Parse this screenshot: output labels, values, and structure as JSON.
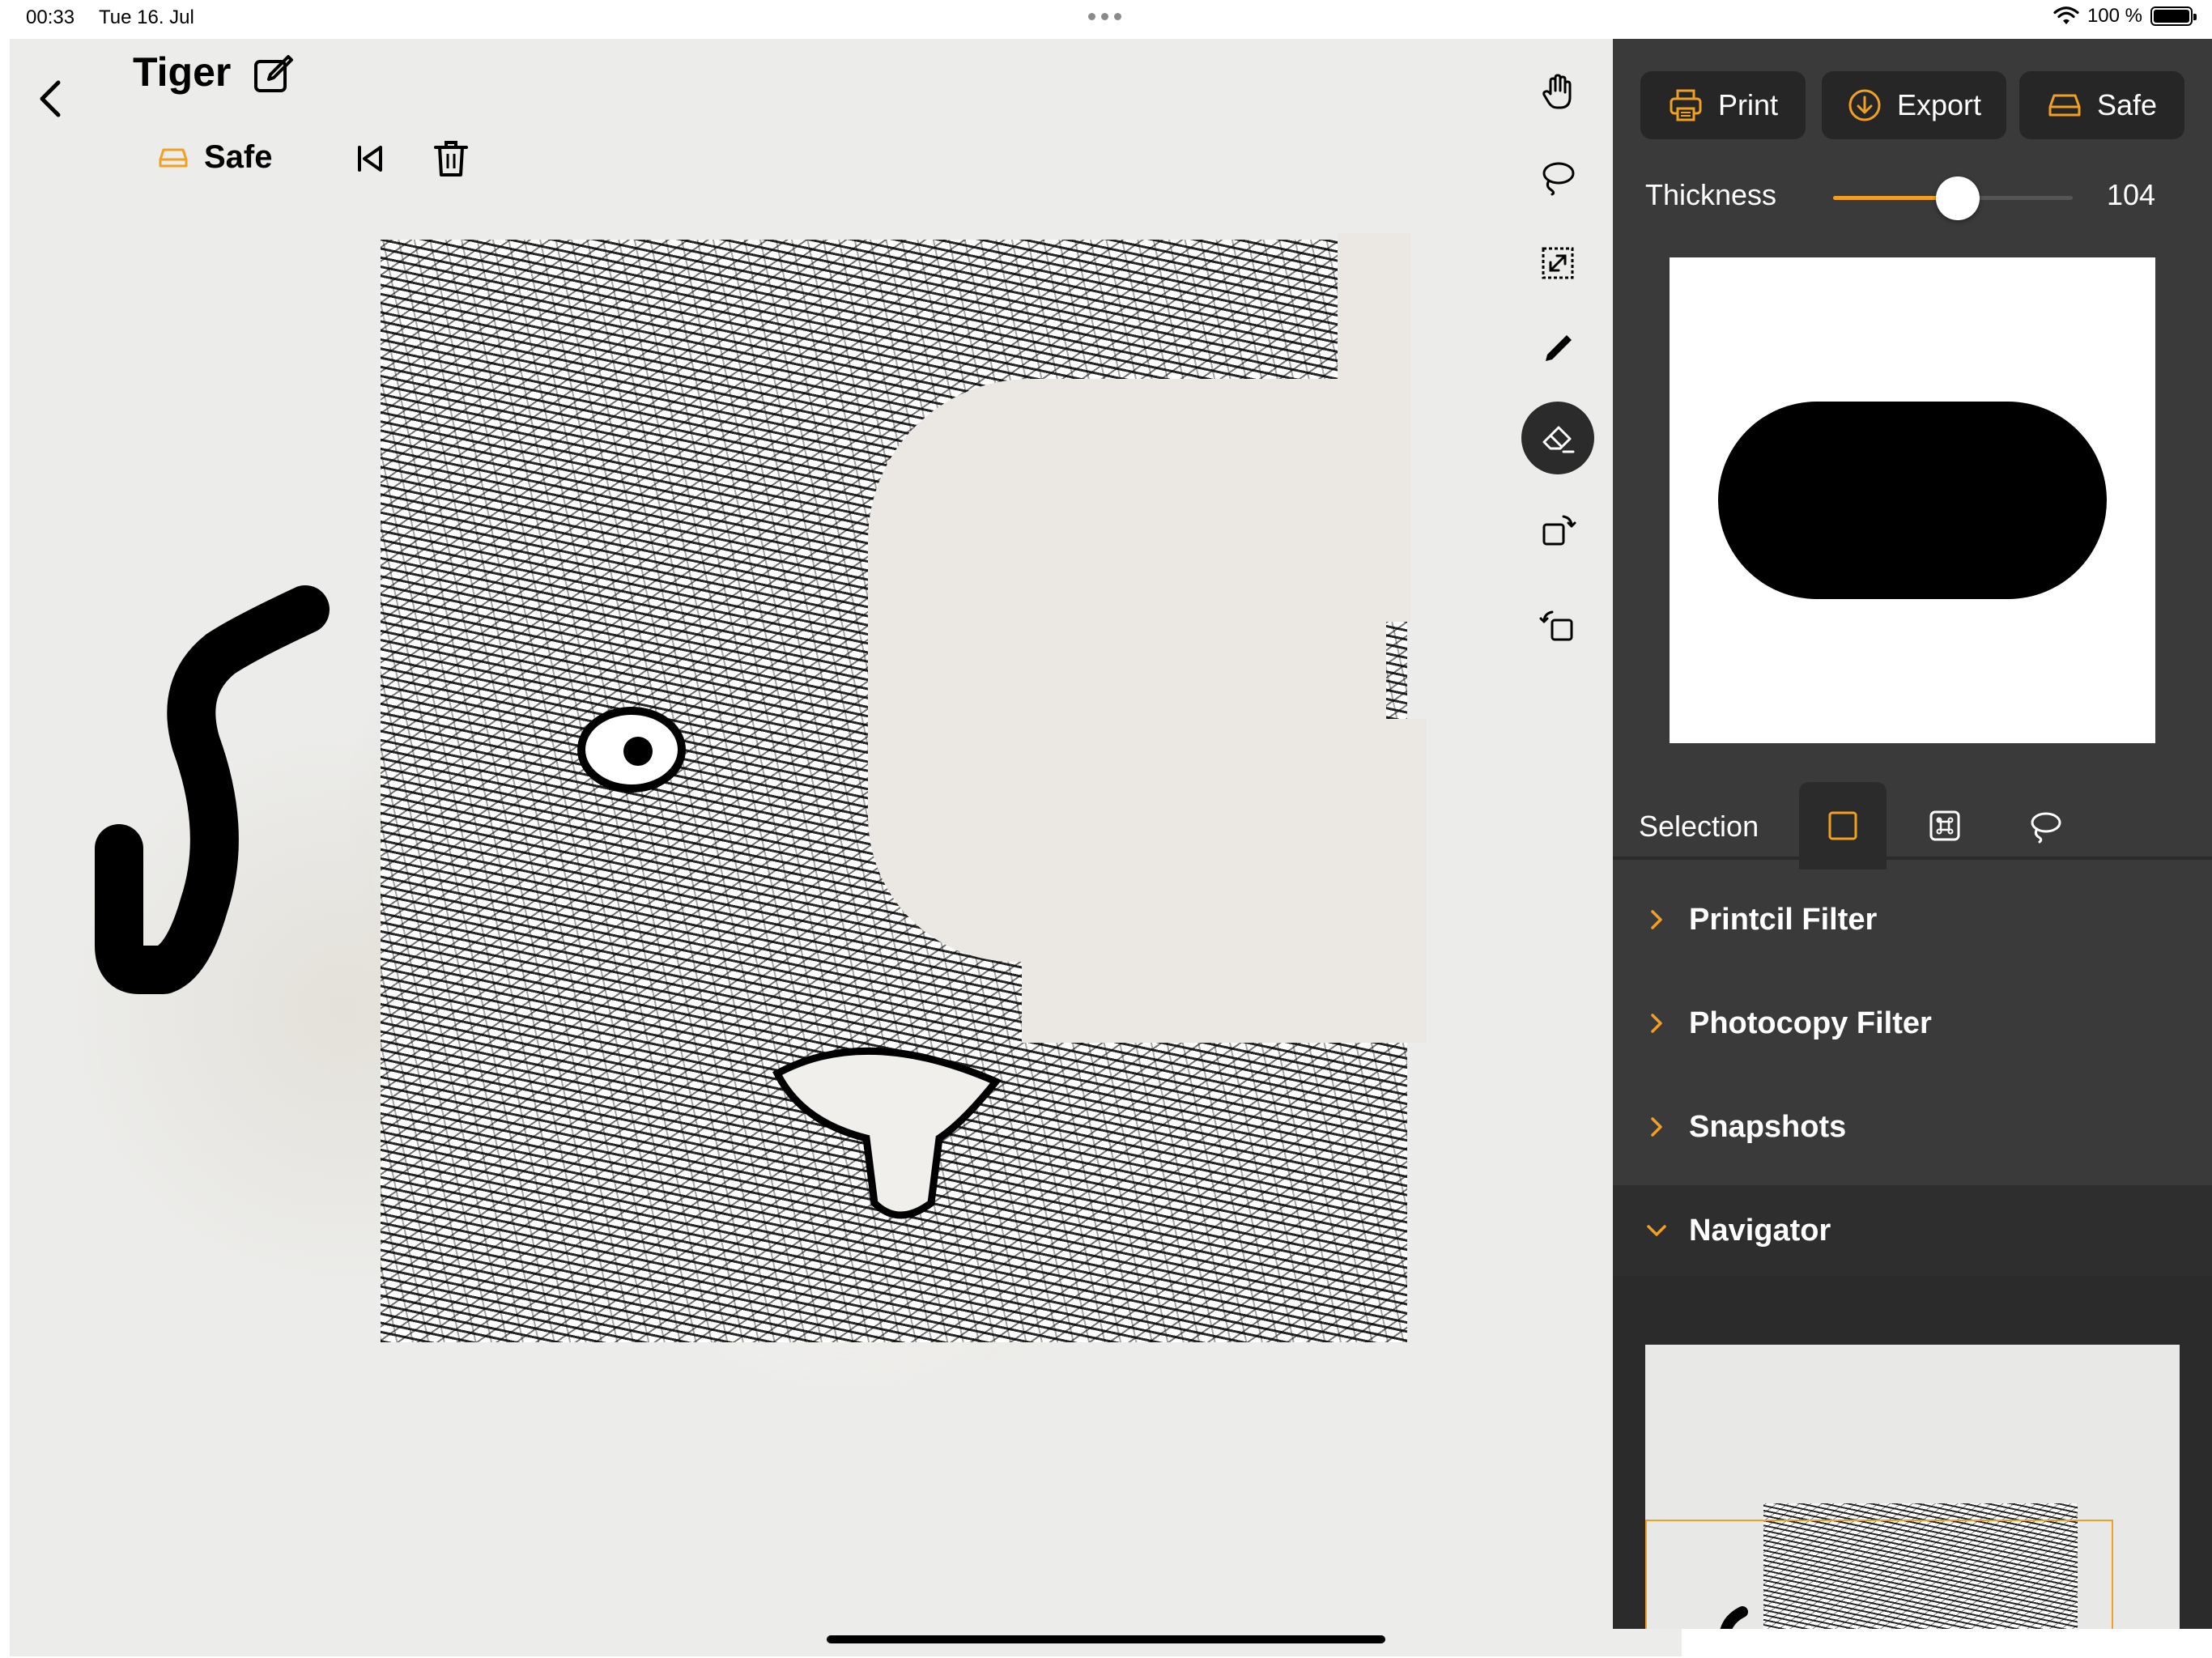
{
  "status_bar": {
    "time": "00:33",
    "date": "Tue 16. Jul",
    "battery": "100 %"
  },
  "document": {
    "title": "Tiger",
    "save_status": "Safe"
  },
  "toolbar": {
    "tools": [
      {
        "name": "hand-tool",
        "icon": "hand-icon",
        "active": false
      },
      {
        "name": "lasso-tool",
        "icon": "lasso-icon",
        "active": false
      },
      {
        "name": "resize-tool",
        "icon": "resize-icon",
        "active": false
      },
      {
        "name": "pencil-tool",
        "icon": "pencil-icon",
        "active": false
      },
      {
        "name": "eraser-tool",
        "icon": "eraser-icon",
        "active": true
      },
      {
        "name": "rotate-right-tool",
        "icon": "rotate-right-icon",
        "active": false
      },
      {
        "name": "rotate-left-tool",
        "icon": "rotate-left-icon",
        "active": false
      }
    ]
  },
  "panel": {
    "print_label": "Print",
    "export_label": "Export",
    "safe_label": "Safe",
    "thickness_label": "Thickness",
    "thickness_value": "104",
    "thickness_fraction": 0.52,
    "selection_label": "Selection",
    "selection_modes": [
      "rectangle-select-icon",
      "command-select-icon",
      "lasso-select-icon"
    ],
    "sections": [
      {
        "label": "Printcil Filter",
        "expanded": false
      },
      {
        "label": "Photocopy Filter",
        "expanded": false
      },
      {
        "label": "Snapshots",
        "expanded": false
      },
      {
        "label": "Navigator",
        "expanded": true
      }
    ]
  },
  "colors": {
    "accent": "#f0a024",
    "panel_bg": "#3a3a3a",
    "button_bg": "#262626"
  }
}
